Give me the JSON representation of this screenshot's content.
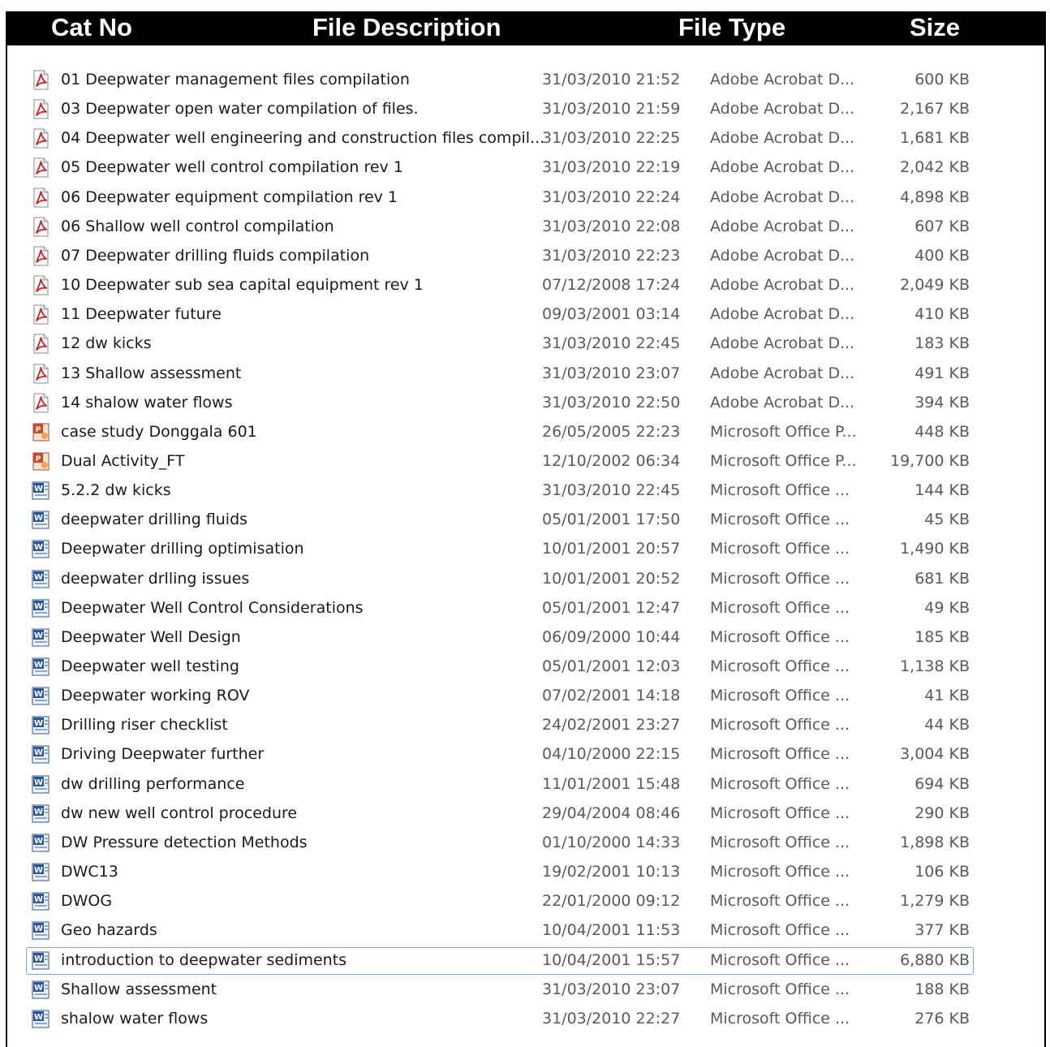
{
  "header": {
    "col_cat": "Cat No",
    "col_desc": "File Description",
    "col_type": "File Type",
    "col_size": "Size"
  },
  "files": [
    {
      "name": "01 Deepwater management files compilation",
      "date": "31/03/2010 21:52",
      "type": "Adobe Acrobat D...",
      "size": "600 KB",
      "icon": "pdf-icon"
    },
    {
      "name": "03 Deepwater open water compilation of files.",
      "date": "31/03/2010 21:59",
      "type": "Adobe Acrobat D...",
      "size": "2,167 KB",
      "icon": "pdf-icon"
    },
    {
      "name": "04 Deepwater well engineering and construction files compil...",
      "date": "31/03/2010 22:25",
      "type": "Adobe Acrobat D...",
      "size": "1,681 KB",
      "icon": "pdf-icon"
    },
    {
      "name": "05 Deepwater well control compilation rev 1",
      "date": "31/03/2010 22:19",
      "type": "Adobe Acrobat D...",
      "size": "2,042 KB",
      "icon": "pdf-icon"
    },
    {
      "name": "06 Deepwater equipment compilation rev 1",
      "date": "31/03/2010 22:24",
      "type": "Adobe Acrobat D...",
      "size": "4,898 KB",
      "icon": "pdf-icon"
    },
    {
      "name": "06 Shallow well control compilation",
      "date": "31/03/2010 22:08",
      "type": "Adobe Acrobat D...",
      "size": "607 KB",
      "icon": "pdf-icon"
    },
    {
      "name": "07 Deepwater drilling fluids compilation",
      "date": "31/03/2010 22:23",
      "type": "Adobe Acrobat D...",
      "size": "400 KB",
      "icon": "pdf-icon"
    },
    {
      "name": "10 Deepwater sub sea capital equipment rev 1",
      "date": "07/12/2008 17:24",
      "type": "Adobe Acrobat D...",
      "size": "2,049 KB",
      "icon": "pdf-icon"
    },
    {
      "name": "11 Deepwater future",
      "date": "09/03/2001 03:14",
      "type": "Adobe Acrobat D...",
      "size": "410 KB",
      "icon": "pdf-icon"
    },
    {
      "name": "12 dw kicks",
      "date": "31/03/2010 22:45",
      "type": "Adobe Acrobat D...",
      "size": "183 KB",
      "icon": "pdf-icon"
    },
    {
      "name": "13 Shallow assessment",
      "date": "31/03/2010 23:07",
      "type": "Adobe Acrobat D...",
      "size": "491 KB",
      "icon": "pdf-icon"
    },
    {
      "name": "14 shalow water flows",
      "date": "31/03/2010 22:50",
      "type": "Adobe Acrobat D...",
      "size": "394 KB",
      "icon": "pdf-icon"
    },
    {
      "name": "case study Donggala 601",
      "date": "26/05/2005 22:23",
      "type": "Microsoft Office P...",
      "size": "448 KB",
      "icon": "powerpoint-icon"
    },
    {
      "name": "Dual Activity_FT",
      "date": "12/10/2002 06:34",
      "type": "Microsoft Office P...",
      "size": "19,700 KB",
      "icon": "powerpoint-icon"
    },
    {
      "name": "5.2.2 dw kicks",
      "date": "31/03/2010 22:45",
      "type": "Microsoft Office ...",
      "size": "144 KB",
      "icon": "word-icon"
    },
    {
      "name": "deepwater drilling fluids",
      "date": "05/01/2001 17:50",
      "type": "Microsoft Office ...",
      "size": "45 KB",
      "icon": "word-icon"
    },
    {
      "name": "Deepwater drilling optimisation",
      "date": "10/01/2001 20:57",
      "type": "Microsoft Office ...",
      "size": "1,490 KB",
      "icon": "word-icon"
    },
    {
      "name": "deepwater drlling issues",
      "date": "10/01/2001 20:52",
      "type": "Microsoft Office ...",
      "size": "681 KB",
      "icon": "word-icon"
    },
    {
      "name": "Deepwater Well Control Considerations",
      "date": "05/01/2001 12:47",
      "type": "Microsoft Office ...",
      "size": "49 KB",
      "icon": "word-icon"
    },
    {
      "name": "Deepwater Well Design",
      "date": "06/09/2000 10:44",
      "type": "Microsoft Office ...",
      "size": "185 KB",
      "icon": "word-icon"
    },
    {
      "name": "Deepwater well testing",
      "date": "05/01/2001 12:03",
      "type": "Microsoft Office ...",
      "size": "1,138 KB",
      "icon": "word-icon"
    },
    {
      "name": "Deepwater working ROV",
      "date": "07/02/2001 14:18",
      "type": "Microsoft Office ...",
      "size": "41 KB",
      "icon": "word-icon"
    },
    {
      "name": "Drilling riser checklist",
      "date": "24/02/2001 23:27",
      "type": "Microsoft Office ...",
      "size": "44 KB",
      "icon": "word-icon"
    },
    {
      "name": "Driving Deepwater further",
      "date": "04/10/2000 22:15",
      "type": "Microsoft Office ...",
      "size": "3,004 KB",
      "icon": "word-icon"
    },
    {
      "name": "dw drilling performance",
      "date": "11/01/2001 15:48",
      "type": "Microsoft Office ...",
      "size": "694 KB",
      "icon": "word-icon"
    },
    {
      "name": "dw new well control procedure",
      "date": "29/04/2004 08:46",
      "type": "Microsoft Office ...",
      "size": "290 KB",
      "icon": "word-icon"
    },
    {
      "name": "DW Pressure detection   Methods",
      "date": "01/10/2000 14:33",
      "type": "Microsoft Office ...",
      "size": "1,898 KB",
      "icon": "word-icon"
    },
    {
      "name": "DWC13",
      "date": "19/02/2001 10:13",
      "type": "Microsoft Office ...",
      "size": "106 KB",
      "icon": "word-icon"
    },
    {
      "name": "DWOG",
      "date": "22/01/2000 09:12",
      "type": "Microsoft Office ...",
      "size": "1,279 KB",
      "icon": "word-icon"
    },
    {
      "name": "Geo hazards",
      "date": "10/04/2001 11:53",
      "type": "Microsoft Office ...",
      "size": "377 KB",
      "icon": "word-icon"
    },
    {
      "name": "introduction to deepwater sediments",
      "date": "10/04/2001 15:57",
      "type": "Microsoft Office ...",
      "size": "6,880 KB",
      "icon": "word-icon",
      "selected": true
    },
    {
      "name": "Shallow assessment",
      "date": "31/03/2010 23:07",
      "type": "Microsoft Office ...",
      "size": "188 KB",
      "icon": "word-icon"
    },
    {
      "name": "shalow water flows",
      "date": "31/03/2010 22:27",
      "type": "Microsoft Office ...",
      "size": "276 KB",
      "icon": "word-icon"
    }
  ],
  "colors": {
    "header_bg": "#000000",
    "header_text": "#ffffff",
    "pdf_red": "#cc1f1f",
    "word_blue": "#2b5797",
    "ppt_orange": "#d24726",
    "selection_border": "#7da2ce"
  }
}
